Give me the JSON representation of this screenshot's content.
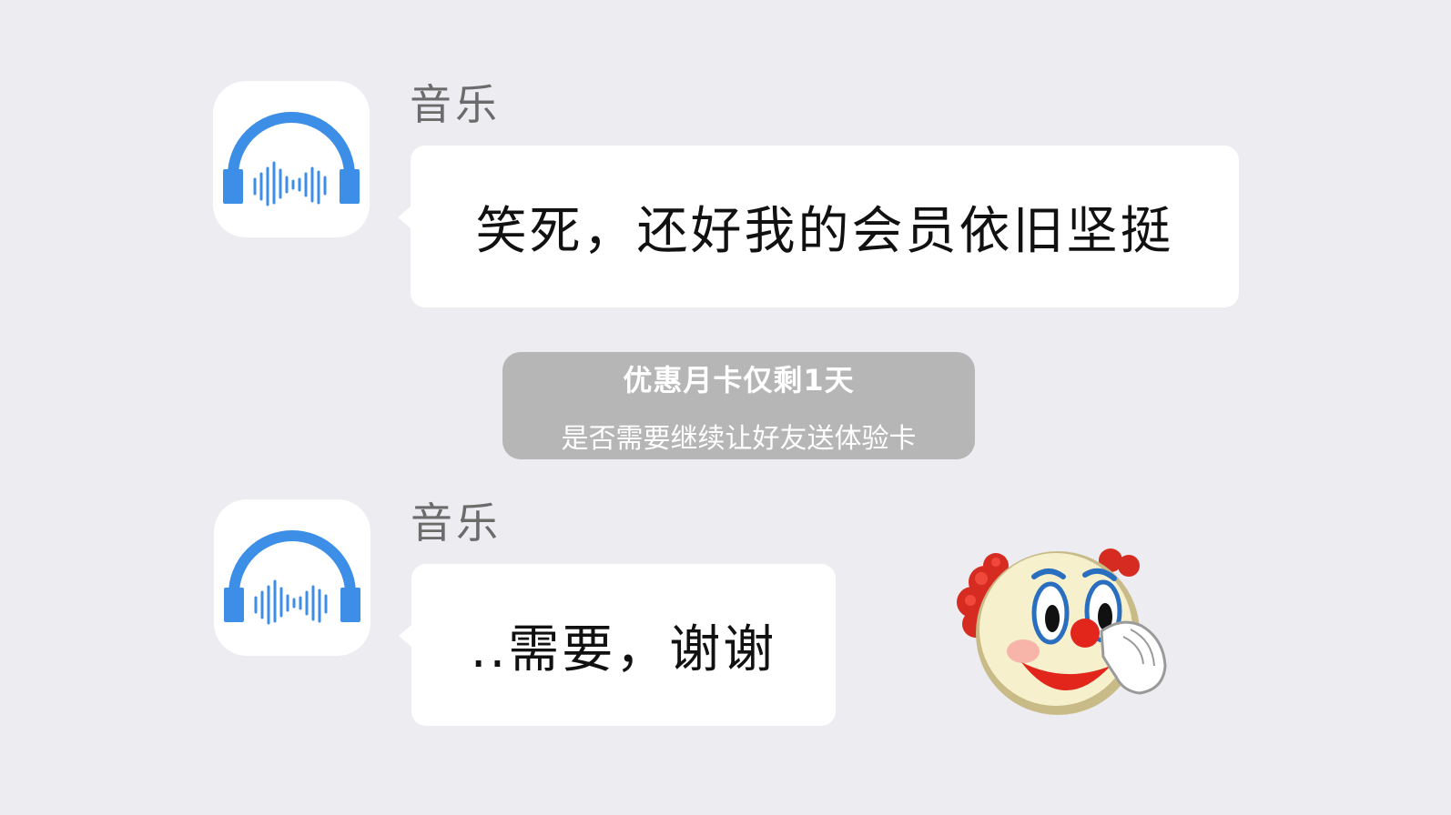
{
  "messages": [
    {
      "sender": "音乐",
      "avatar_icon": "headphones-icon",
      "text": "笑死，还好我的会员依旧坚挺"
    },
    {
      "sender": "音乐",
      "avatar_icon": "headphones-icon",
      "text": "..需要，谢谢"
    }
  ],
  "notice": {
    "title": "优惠月卡仅剩1天",
    "subtitle": "是否需要继续让好友送体验卡"
  },
  "sticker": {
    "icon": "clown-face-icon"
  },
  "colors": {
    "background": "#ececf1",
    "bubble": "#ffffff",
    "notice_bg": "#b6b6b6",
    "accent_blue": "#3d8ee6"
  }
}
